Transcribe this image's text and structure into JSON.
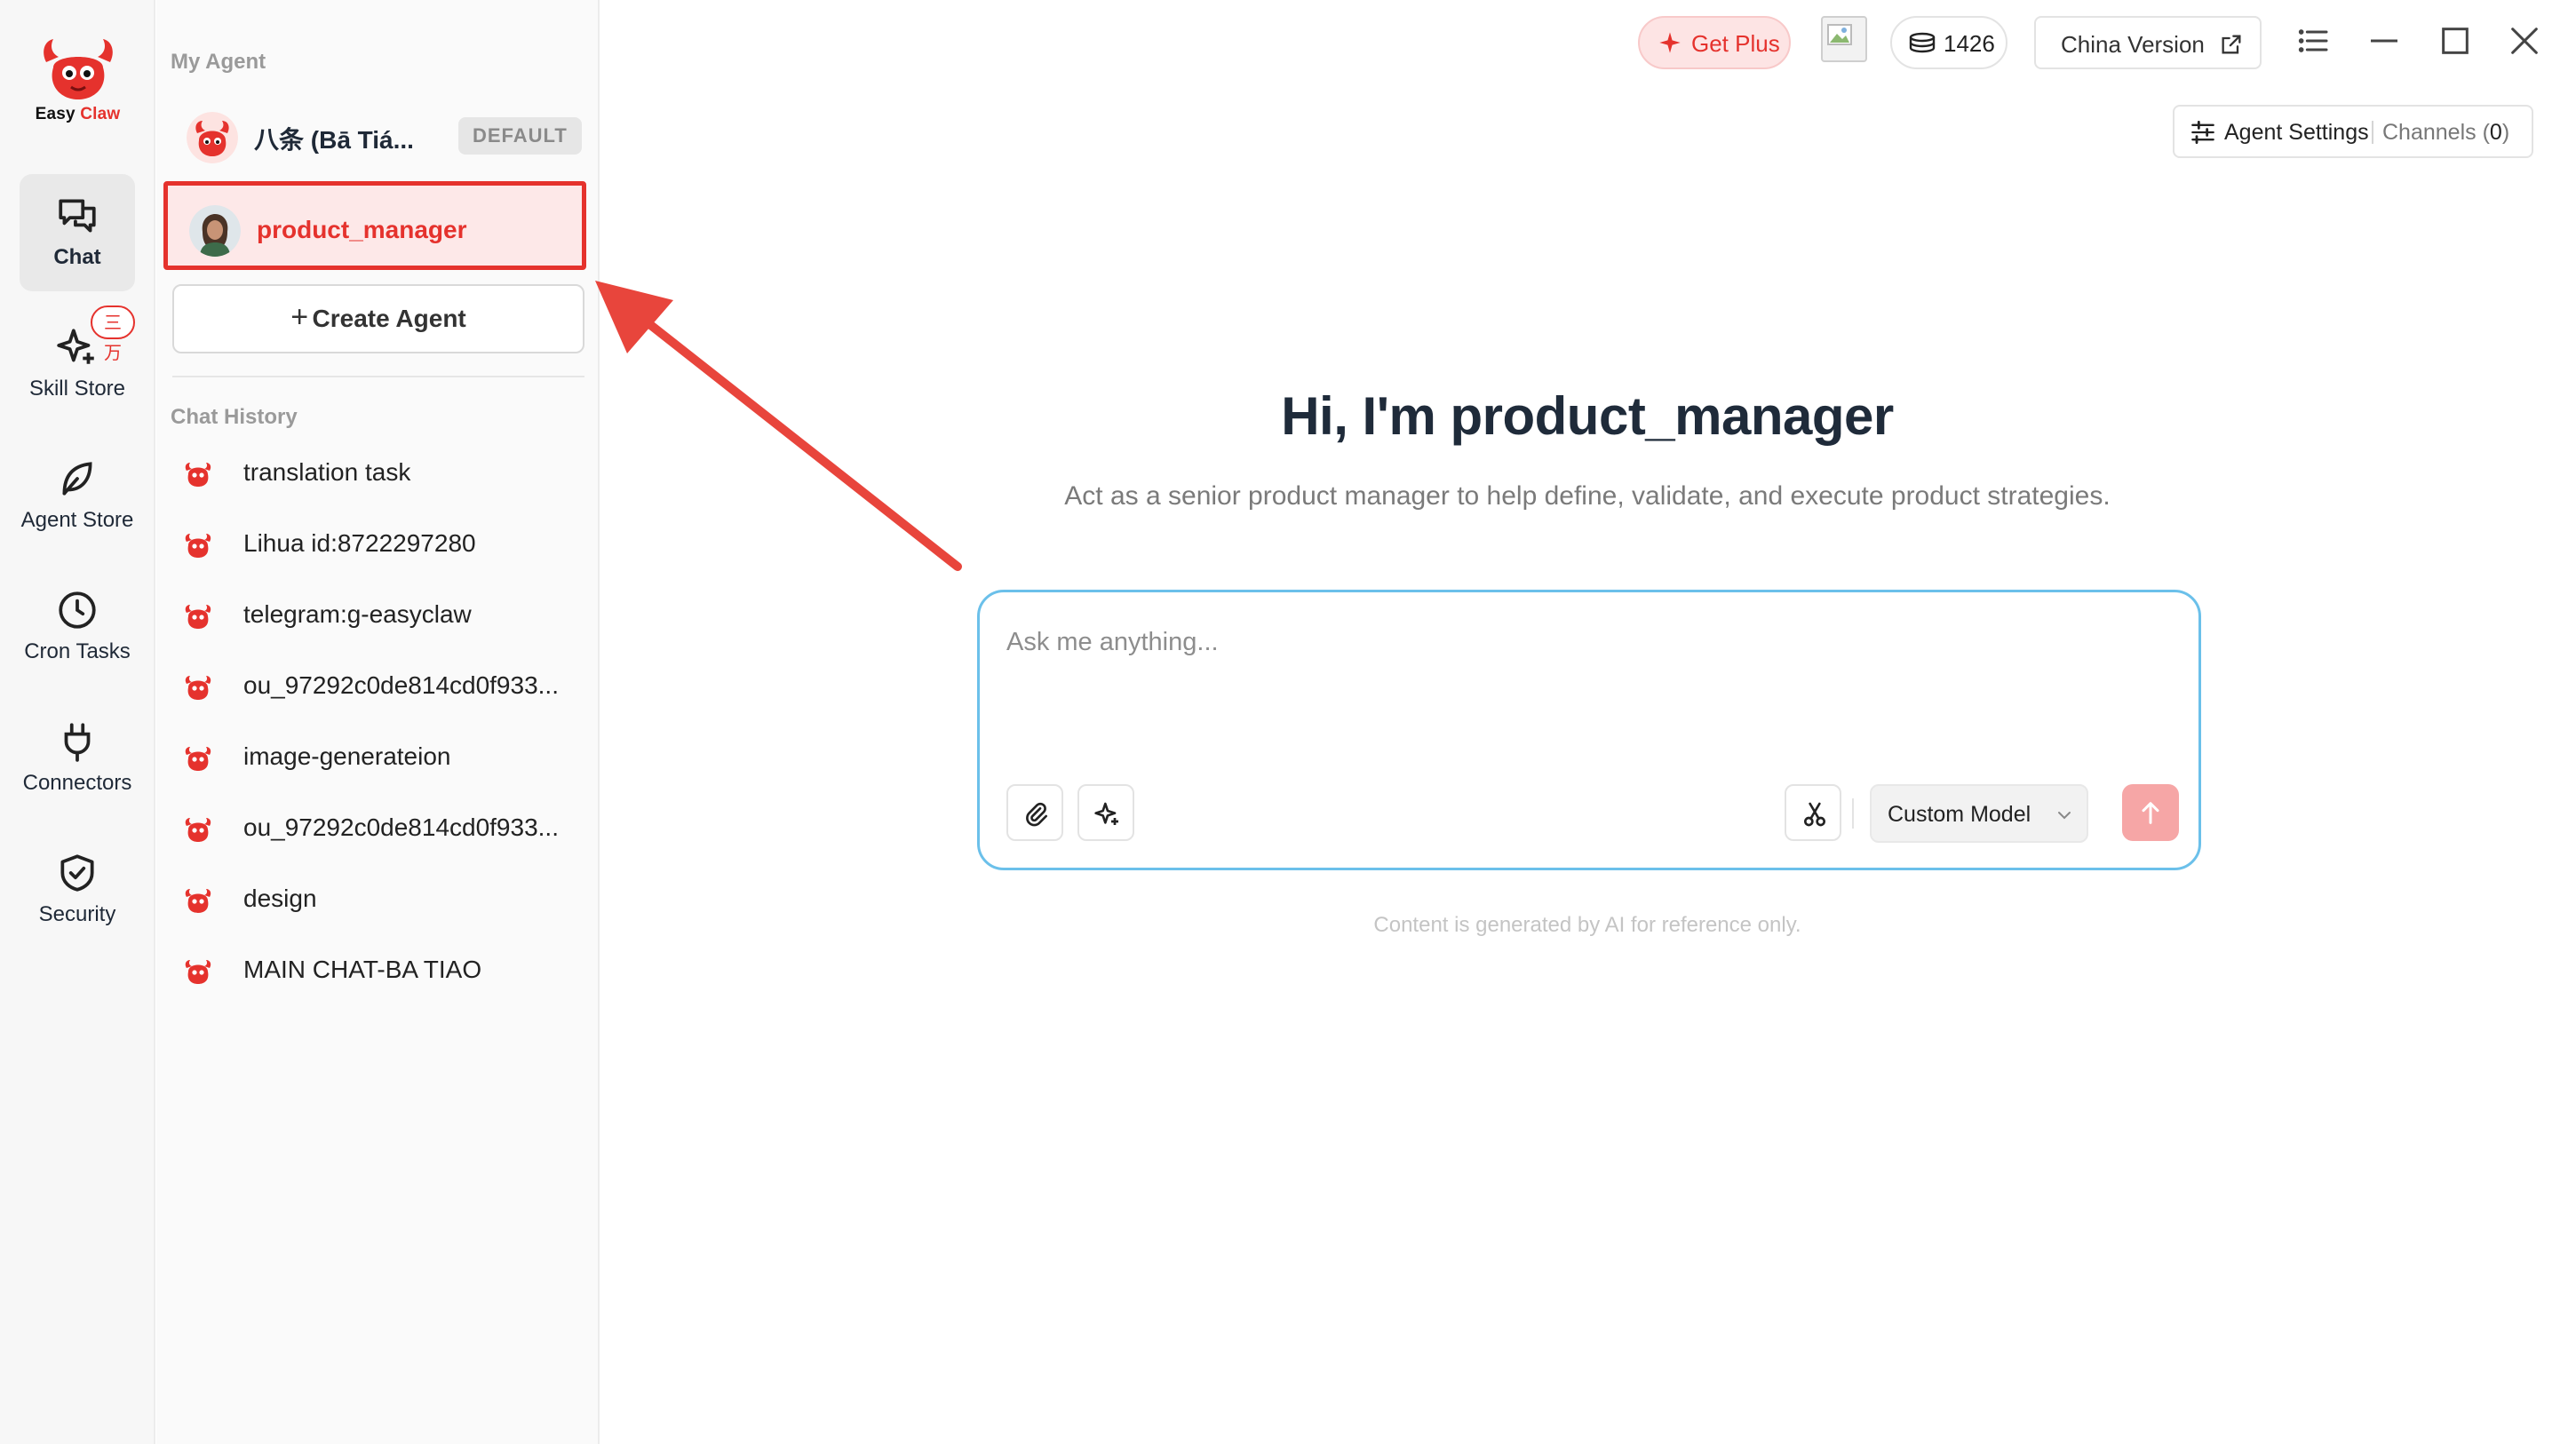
{
  "app": {
    "logo_easy": "Easy",
    "logo_claw": "Claw",
    "accent_color": "#e5322d"
  },
  "rail": {
    "items": [
      {
        "label": "Chat",
        "icon": "chat-icon",
        "active": true
      },
      {
        "label": "Skill Store",
        "icon": "sparkle-icon",
        "badge": "三万"
      },
      {
        "label": "Agent Store",
        "icon": "leaf-icon"
      },
      {
        "label": "Cron Tasks",
        "icon": "clock-icon"
      },
      {
        "label": "Connectors",
        "icon": "plug-icon"
      },
      {
        "label": "Security",
        "icon": "shield-icon"
      }
    ]
  },
  "panel": {
    "my_agent_label": "My Agent",
    "agents": [
      {
        "name": "八条 (Bā Tiá...",
        "badge": "DEFAULT"
      },
      {
        "name": "product_manager",
        "selected": true
      }
    ],
    "create_agent_plus": "+",
    "create_agent_label": "Create Agent",
    "chat_history_label": "Chat History",
    "history": [
      "translation task",
      "Lihua id:8722297280",
      "telegram:g-easyclaw",
      "ou_97292c0de814cd0f933...",
      "image-generateion",
      "ou_97292c0de814cd0f933...",
      "design",
      "MAIN CHAT-BA TIAO"
    ]
  },
  "topbar": {
    "get_plus": "Get Plus",
    "credits": "1426",
    "china_version": "China Version"
  },
  "agent_settings": {
    "label": "Agent Settings",
    "channels_label": "Channels (",
    "channels_count": "0",
    "channels_close": ")"
  },
  "main": {
    "greeting": "Hi, I'm product_manager",
    "subtitle": "Act as a senior product manager to help define, validate, and execute product strategies.",
    "input_placeholder": "Ask me anything...",
    "model": "Custom Model",
    "disclaimer": "Content is generated by AI for reference only."
  }
}
